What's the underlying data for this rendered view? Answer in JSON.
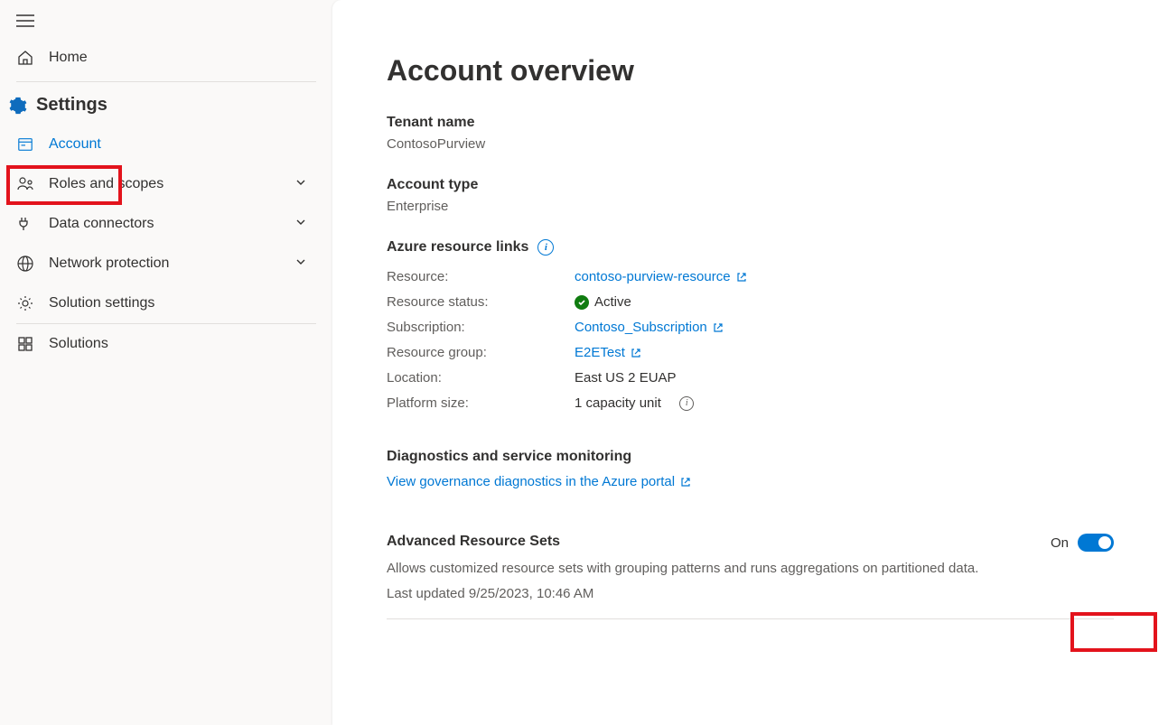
{
  "sidebar": {
    "home": "Home",
    "settings_heading": "Settings",
    "items": {
      "account": "Account",
      "roles": "Roles and scopes",
      "connectors": "Data connectors",
      "network": "Network protection",
      "solution_settings": "Solution settings",
      "solutions": "Solutions"
    }
  },
  "main": {
    "title": "Account overview",
    "tenant": {
      "label": "Tenant name",
      "value": "ContosoPurview"
    },
    "account_type": {
      "label": "Account type",
      "value": "Enterprise"
    },
    "azure_links": {
      "heading": "Azure resource links",
      "rows": {
        "resource": {
          "k": "Resource:",
          "v": "contoso-purview-resource"
        },
        "status": {
          "k": "Resource status:",
          "v": "Active"
        },
        "subscription": {
          "k": "Subscription:",
          "v": "Contoso_Subscription"
        },
        "group": {
          "k": "Resource group:",
          "v": "E2ETest"
        },
        "location": {
          "k": "Location:",
          "v": "East US 2 EUAP"
        },
        "platform": {
          "k": "Platform size:",
          "v": "1 capacity unit"
        }
      }
    },
    "diagnostics": {
      "heading": "Diagnostics and service monitoring",
      "link": "View governance diagnostics in the Azure portal"
    },
    "advanced": {
      "heading": "Advanced Resource Sets",
      "desc": "Allows customized resource sets with grouping patterns and runs aggregations on partitioned data.",
      "updated": "Last updated 9/25/2023, 10:46 AM",
      "toggle_label": "On"
    }
  }
}
